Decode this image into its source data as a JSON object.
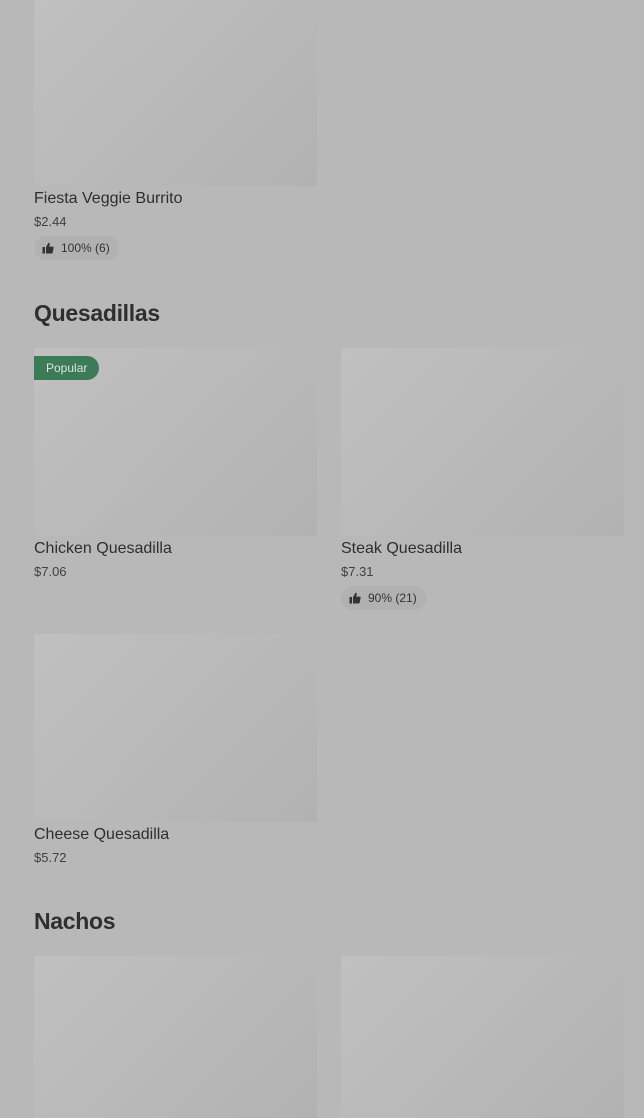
{
  "sections": {
    "burritos_tail": {
      "items": [
        {
          "name": "Fiesta Veggie Burrito",
          "price": "$2.44",
          "rating": "100% (6)"
        }
      ]
    },
    "quesadillas": {
      "title": "Quesadillas",
      "items": [
        {
          "name": "Chicken Quesadilla",
          "price": "$7.06",
          "badge": "Popular"
        },
        {
          "name": "Steak Quesadilla",
          "price": "$7.31",
          "rating": "90% (21)"
        },
        {
          "name": "Cheese Quesadilla",
          "price": "$5.72"
        }
      ]
    },
    "nachos": {
      "title": "Nachos"
    }
  },
  "colors": {
    "page_background": "#b8b8b8",
    "badge_background": "#3d7a58",
    "rating_pill_background": "#b1b1b1"
  },
  "icons": {
    "rating": "thumbs-up-icon"
  }
}
